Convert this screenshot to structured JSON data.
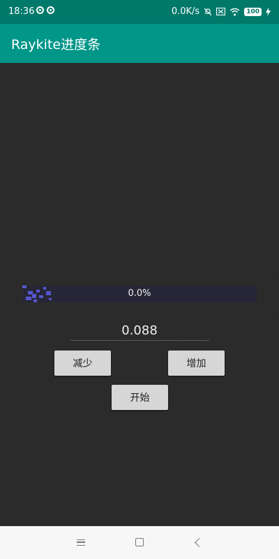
{
  "status_bar": {
    "time": "18:36",
    "network_speed": "0.0K/s",
    "battery": "100",
    "icons": [
      "notification-icon",
      "notification-icon",
      "mute-icon",
      "sim-icon",
      "wifi-icon",
      "battery-icon",
      "charging-icon"
    ]
  },
  "app_bar": {
    "title": "Raykite进度条",
    "color": "#009688"
  },
  "progress": {
    "label": "0.0%",
    "value": 0.0,
    "fill_color": "#5a5ad6",
    "track_color": "#262637"
  },
  "input": {
    "value": "0.088"
  },
  "buttons": {
    "decrease": "减少",
    "increase": "增加",
    "start": "开始"
  },
  "nav_bar": {
    "icons": [
      "menu-icon",
      "home-icon",
      "back-icon"
    ]
  }
}
